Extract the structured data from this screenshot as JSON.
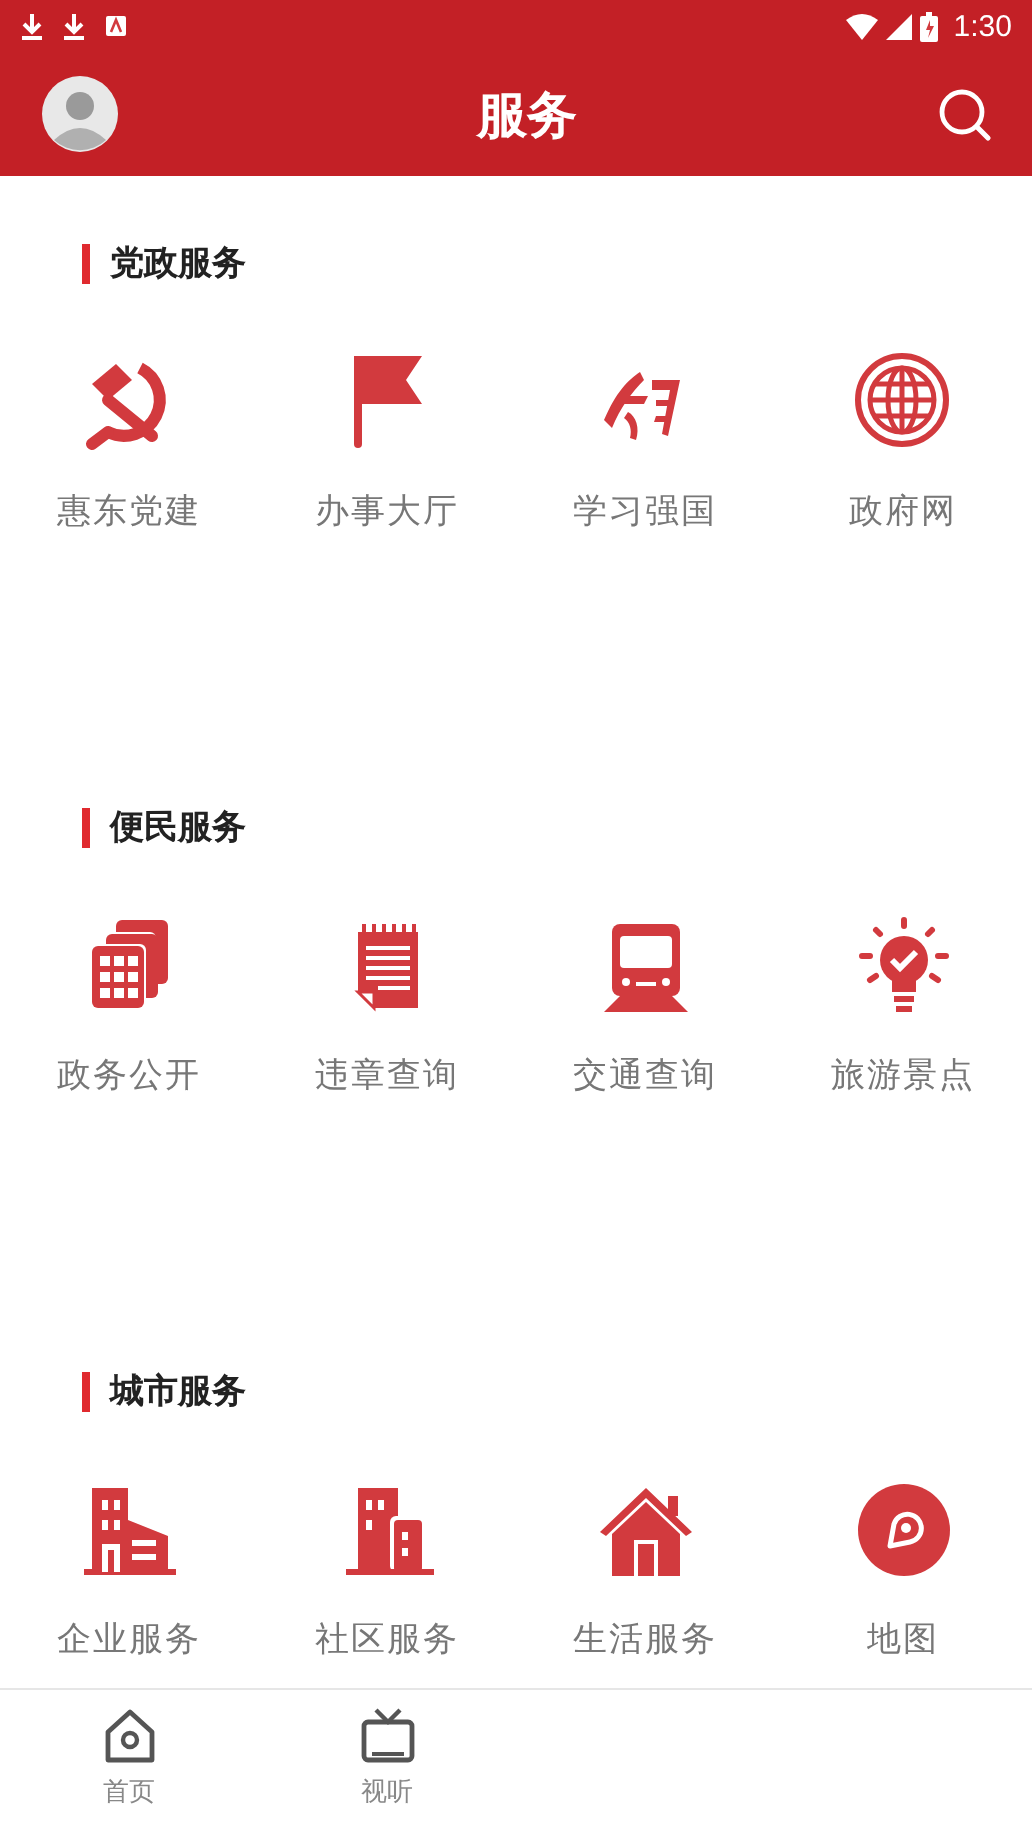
{
  "status_bar": {
    "time": "1:30"
  },
  "header": {
    "title": "服务"
  },
  "sections": [
    {
      "title": "党政服务",
      "items": [
        {
          "label": "惠东党建"
        },
        {
          "label": "办事大厅"
        },
        {
          "label": "学习强国"
        },
        {
          "label": "政府网"
        }
      ]
    },
    {
      "title": "便民服务",
      "items": [
        {
          "label": "政务公开"
        },
        {
          "label": "违章查询"
        },
        {
          "label": "交通查询"
        },
        {
          "label": "旅游景点"
        }
      ]
    },
    {
      "title": "城市服务",
      "items": [
        {
          "label": "企业服务"
        },
        {
          "label": "社区服务"
        },
        {
          "label": "生活服务"
        },
        {
          "label": "地图"
        }
      ]
    }
  ],
  "bottom_nav": [
    {
      "label": "首页",
      "selected": false
    },
    {
      "label": "视听",
      "selected": false
    }
  ]
}
